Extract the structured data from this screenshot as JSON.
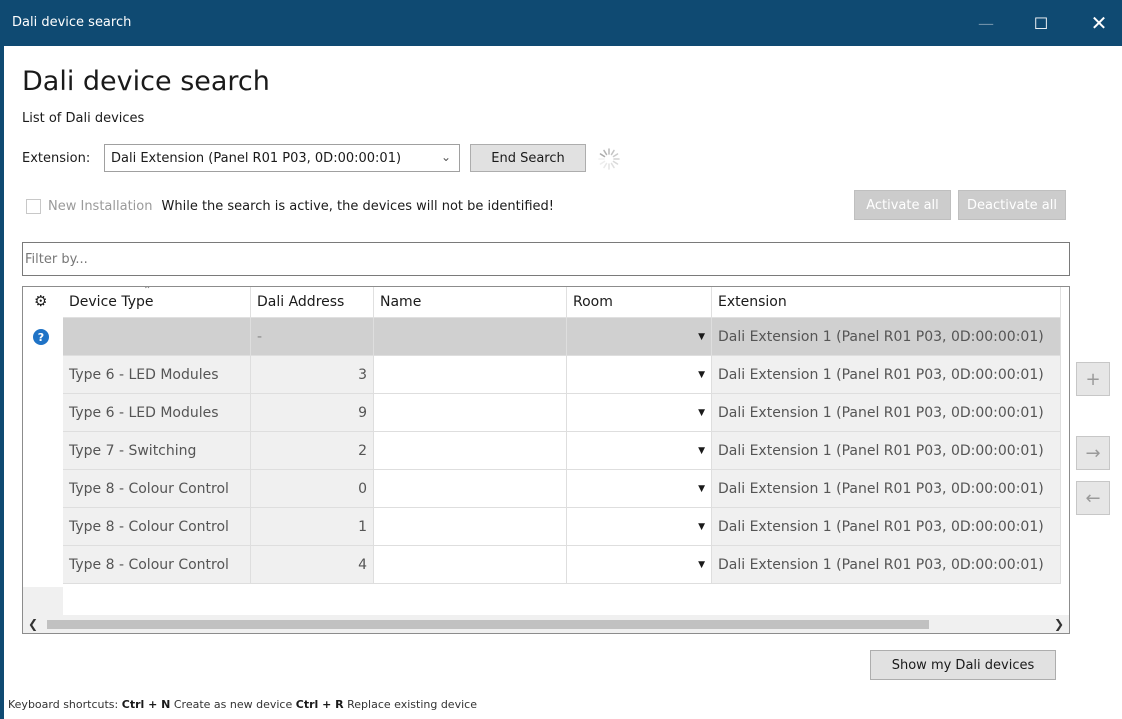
{
  "window": {
    "title": "Dali device search",
    "minimize": "—",
    "maximize": "☐",
    "close": "✕"
  },
  "heading": "Dali device search",
  "subheading": "List of Dali devices",
  "extension": {
    "label": "Extension:",
    "selected": "Dali Extension (Panel R01 P03, 0D:00:00:01)"
  },
  "buttons": {
    "end_search": "End Search",
    "activate_all": "Activate all",
    "deactivate_all": "Deactivate all",
    "show_my_devices": "Show my Dali devices",
    "add": "+",
    "move_right": "→",
    "move_left": "←"
  },
  "new_installation": {
    "label": "New Installation",
    "checked": false
  },
  "warning": "While the search is active, the devices will not be identified!",
  "filter": {
    "placeholder": "Filter by..."
  },
  "table": {
    "columns": [
      "Device Type",
      "Dali Address",
      "Name",
      "Room",
      "Extension"
    ],
    "rows": [
      {
        "type": "",
        "address": "-",
        "name": "",
        "room": "",
        "extension": "Dali Extension 1 (Panel R01 P03, 0D:00:00:01)"
      },
      {
        "type": "Type 6 - LED Modules",
        "address": "3",
        "name": "",
        "room": "",
        "extension": "Dali Extension 1 (Panel R01 P03, 0D:00:00:01)"
      },
      {
        "type": "Type 6 - LED Modules",
        "address": "9",
        "name": "",
        "room": "",
        "extension": "Dali Extension 1 (Panel R01 P03, 0D:00:00:01)"
      },
      {
        "type": "Type 7 - Switching",
        "address": "2",
        "name": "",
        "room": "",
        "extension": "Dali Extension 1 (Panel R01 P03, 0D:00:00:01)"
      },
      {
        "type": "Type 8 - Colour Control",
        "address": "0",
        "name": "",
        "room": "",
        "extension": "Dali Extension 1 (Panel R01 P03, 0D:00:00:01)"
      },
      {
        "type": "Type 8 - Colour Control",
        "address": "1",
        "name": "",
        "room": "",
        "extension": "Dali Extension 1 (Panel R01 P03, 0D:00:00:01)"
      },
      {
        "type": "Type 8 - Colour Control",
        "address": "4",
        "name": "",
        "room": "",
        "extension": "Dali Extension 1 (Panel R01 P03, 0D:00:00:01)"
      }
    ]
  },
  "shortcuts": {
    "prefix": "Keyboard shortcuts:",
    "key1": "Ctrl + N",
    "action1": "Create as new device",
    "key2": "Ctrl + R",
    "action2": "Replace existing device"
  },
  "colors": {
    "titlebar": "#0f4a72",
    "help_icon": "#1f73c6"
  }
}
